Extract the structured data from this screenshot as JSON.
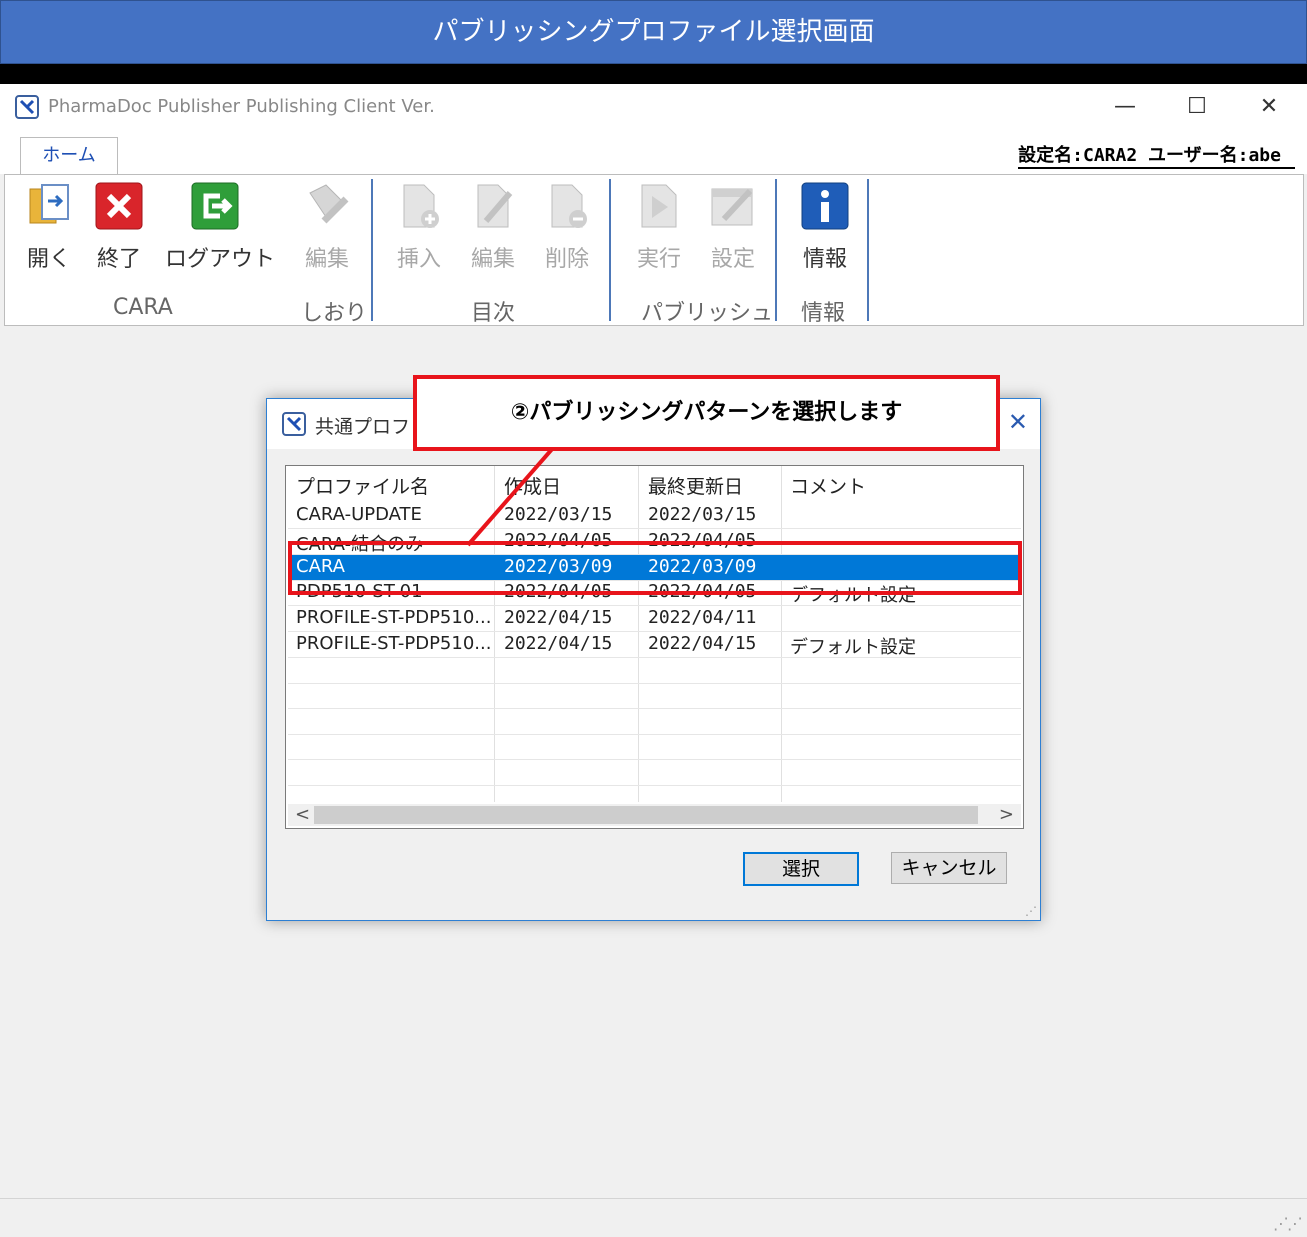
{
  "banner": {
    "title": "パブリッシングプロファイル選択画面"
  },
  "window": {
    "title": "PharmaDoc Publisher Publishing Client Ver.",
    "controls": {
      "minimize": "—",
      "maximize": "☐",
      "close": "✕"
    }
  },
  "tabs": [
    {
      "label": "ホーム"
    }
  ],
  "settings_info": "設定名:CARA2  ユーザー名:abe",
  "ribbon": {
    "groups": [
      {
        "label": "CARA",
        "buttons": [
          {
            "label": "開く",
            "icon": "open-folder-icon",
            "enabled": true
          },
          {
            "label": "終了",
            "icon": "exit-x-icon",
            "enabled": true
          },
          {
            "label": "ログアウト",
            "icon": "logout-icon",
            "enabled": true
          }
        ]
      },
      {
        "label": "しおり",
        "buttons": [
          {
            "label": "編集",
            "icon": "bookmark-edit-icon",
            "enabled": false
          }
        ]
      },
      {
        "label": "目次",
        "buttons": [
          {
            "label": "挿入",
            "icon": "toc-insert-icon",
            "enabled": false
          },
          {
            "label": "編集",
            "icon": "toc-edit-icon",
            "enabled": false
          },
          {
            "label": "削除",
            "icon": "toc-delete-icon",
            "enabled": false
          }
        ]
      },
      {
        "label": "パブリッシュ",
        "buttons": [
          {
            "label": "実行",
            "icon": "run-icon",
            "enabled": false
          },
          {
            "label": "設定",
            "icon": "settings-icon",
            "enabled": false
          }
        ]
      },
      {
        "label": "情報",
        "buttons": [
          {
            "label": "情報",
            "icon": "info-icon",
            "enabled": true
          }
        ]
      }
    ]
  },
  "dialog": {
    "title": "共通プロファ",
    "close": "✕",
    "columns": [
      "プロファイル名",
      "作成日",
      "最終更新日",
      "コメント"
    ],
    "rows": [
      {
        "name": "CARA-UPDATE",
        "created": "2022/03/15",
        "updated": "2022/03/15",
        "comment": ""
      },
      {
        "name": "CARA-結合のみ",
        "created": "2022/04/05",
        "updated": "2022/04/05",
        "comment": ""
      },
      {
        "name": "CARA",
        "created": "2022/03/09",
        "updated": "2022/03/09",
        "comment": ""
      },
      {
        "name": "PDP510-ST-01",
        "created": "2022/04/05",
        "updated": "2022/04/05",
        "comment": "デフォルト設定"
      },
      {
        "name": "PROFILE-ST-PDP510...",
        "created": "2022/04/15",
        "updated": "2022/04/11",
        "comment": ""
      },
      {
        "name": "PROFILE-ST-PDP510...",
        "created": "2022/04/15",
        "updated": "2022/04/15",
        "comment": "デフォルト設定"
      }
    ],
    "selected_index": 2,
    "scroll": {
      "left": "<",
      "right": ">"
    },
    "buttons": {
      "select": "選択",
      "cancel": "キャンセル"
    }
  },
  "callout": {
    "text": "②パブリッシングパターンを選択します"
  },
  "colors": {
    "banner": "#4472c4",
    "highlight": "#e8141b",
    "selection": "#0078d7"
  }
}
